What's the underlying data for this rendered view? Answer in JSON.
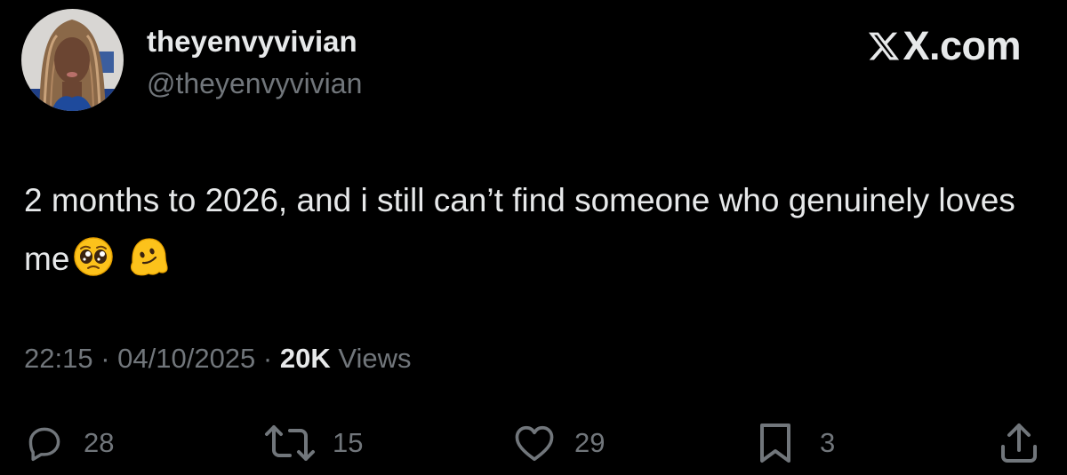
{
  "author": {
    "display_name": "theyenvyvivian",
    "handle": "@theyenvyvivian"
  },
  "brand": {
    "name": "X.com"
  },
  "tweet": {
    "text": "2 months to 2026, and i still can’t find someone who genuinely loves me",
    "emojis": [
      "pleading-face",
      "melting-face"
    ]
  },
  "meta": {
    "time": "22:15",
    "separator": " · ",
    "date": "04/10/2025",
    "views_count": "20K",
    "views_label": " Views"
  },
  "actions": {
    "replies": "28",
    "reposts": "15",
    "likes": "29",
    "bookmarks": "3"
  },
  "colors": {
    "background": "#000000",
    "primary_text": "#e7e9ea",
    "secondary_text": "#71767b"
  }
}
